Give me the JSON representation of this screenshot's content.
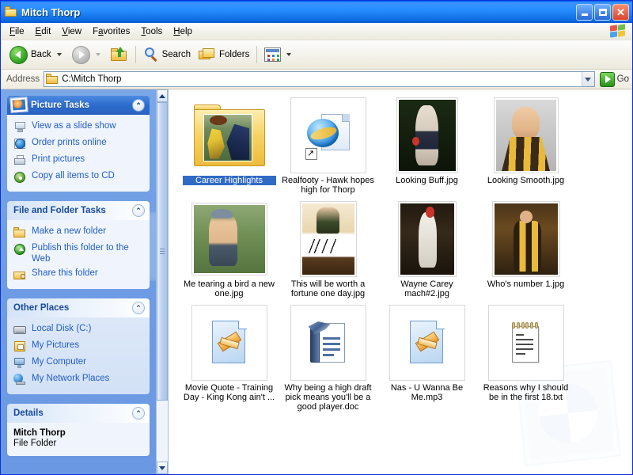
{
  "window": {
    "title": "Mitch Thorp",
    "title_icon": "folder-icon",
    "minimize_label": "Minimize",
    "maximize_label": "Maximize",
    "close_label": "Close"
  },
  "menubar": {
    "items": [
      {
        "label": "File",
        "accel": "F"
      },
      {
        "label": "Edit",
        "accel": "E"
      },
      {
        "label": "View",
        "accel": "V"
      },
      {
        "label": "Favorites",
        "accel": "a"
      },
      {
        "label": "Tools",
        "accel": "T"
      },
      {
        "label": "Help",
        "accel": "H"
      }
    ],
    "logo_icon": "windows-flag-icon"
  },
  "toolbar": {
    "back_label": "Back",
    "back_icon": "back-arrow-icon",
    "forward_icon": "forward-arrow-icon",
    "up_icon": "up-folder-icon",
    "search_label": "Search",
    "search_icon": "magnifier-icon",
    "folders_label": "Folders",
    "folders_icon": "folders-icon",
    "views_icon": "views-icon"
  },
  "addressbar": {
    "label": "Address",
    "value": "C:\\Mitch Thorp",
    "folder_icon": "folder-icon",
    "dropdown_icon": "chevron-down-icon",
    "go_label": "Go",
    "go_icon": "go-arrow-icon"
  },
  "sidebar": {
    "panels": [
      {
        "title": "Picture Tasks",
        "style": "blue",
        "icon": "picture-tasks-icon",
        "collapse_icon": "chevron-up-icon",
        "items": [
          {
            "label": "View as a slide show",
            "icon": "slideshow-icon"
          },
          {
            "label": "Order prints online",
            "icon": "online-prints-icon"
          },
          {
            "label": "Print pictures",
            "icon": "printer-icon"
          },
          {
            "label": "Copy all items to CD",
            "icon": "cd-burn-icon"
          }
        ]
      },
      {
        "title": "File and Folder Tasks",
        "style": "light",
        "collapse_icon": "chevron-up-icon",
        "items": [
          {
            "label": "Make a new folder",
            "icon": "new-folder-icon"
          },
          {
            "label": "Publish this folder to the Web",
            "icon": "publish-web-icon"
          },
          {
            "label": "Share this folder",
            "icon": "share-folder-icon"
          }
        ]
      },
      {
        "title": "Other Places",
        "style": "light",
        "collapse_icon": "chevron-up-icon",
        "items": [
          {
            "label": "Local Disk (C:)",
            "icon": "hard-disk-icon"
          },
          {
            "label": "My Pictures",
            "icon": "my-pictures-icon"
          },
          {
            "label": "My Computer",
            "icon": "my-computer-icon"
          },
          {
            "label": "My Network Places",
            "icon": "network-places-icon"
          }
        ]
      }
    ],
    "details": {
      "title": "Details",
      "collapse_icon": "chevron-up-icon",
      "name": "Mitch Thorp",
      "type": "File Folder"
    }
  },
  "scrollbar": {
    "up_icon": "scroll-up-icon",
    "down_icon": "scroll-down-icon"
  },
  "content": {
    "items": [
      {
        "name": "Career Highlights",
        "kind": "folder-thumbnail",
        "selected": true
      },
      {
        "name": "Realfooty - Hawk hopes high for Thorp",
        "kind": "internet-shortcut",
        "selected": false
      },
      {
        "name": "Looking Buff.jpg",
        "kind": "image-thumbnail",
        "selected": false
      },
      {
        "name": "Looking Smooth.jpg",
        "kind": "image-thumbnail",
        "selected": false
      },
      {
        "name": "Me tearing a bird a new one.jpg",
        "kind": "image-thumbnail",
        "selected": false
      },
      {
        "name": "This will be worth a fortune one day.jpg",
        "kind": "image-thumbnail",
        "selected": false
      },
      {
        "name": "Wayne Carey mach#2.jpg",
        "kind": "image-thumbnail",
        "selected": false
      },
      {
        "name": "Who's number 1.jpg",
        "kind": "image-thumbnail",
        "selected": false
      },
      {
        "name": "Movie Quote - Training Day - King Kong ain't ...",
        "kind": "media-file",
        "selected": false
      },
      {
        "name": "Why being a high draft pick means you'll be a good player.doc",
        "kind": "word-document",
        "selected": false
      },
      {
        "name": "Nas - U Wanna Be Me.mp3",
        "kind": "media-file",
        "selected": false
      },
      {
        "name": "Reasons why I should be in the first 18.txt",
        "kind": "text-document",
        "selected": false
      }
    ]
  },
  "colors": {
    "title_blue": "#0058ee",
    "selection_blue": "#316ac5",
    "link_blue": "#215dc6",
    "panel_header_blue": "#2c6ccd",
    "sidebar_bg": "#6f9de4"
  }
}
